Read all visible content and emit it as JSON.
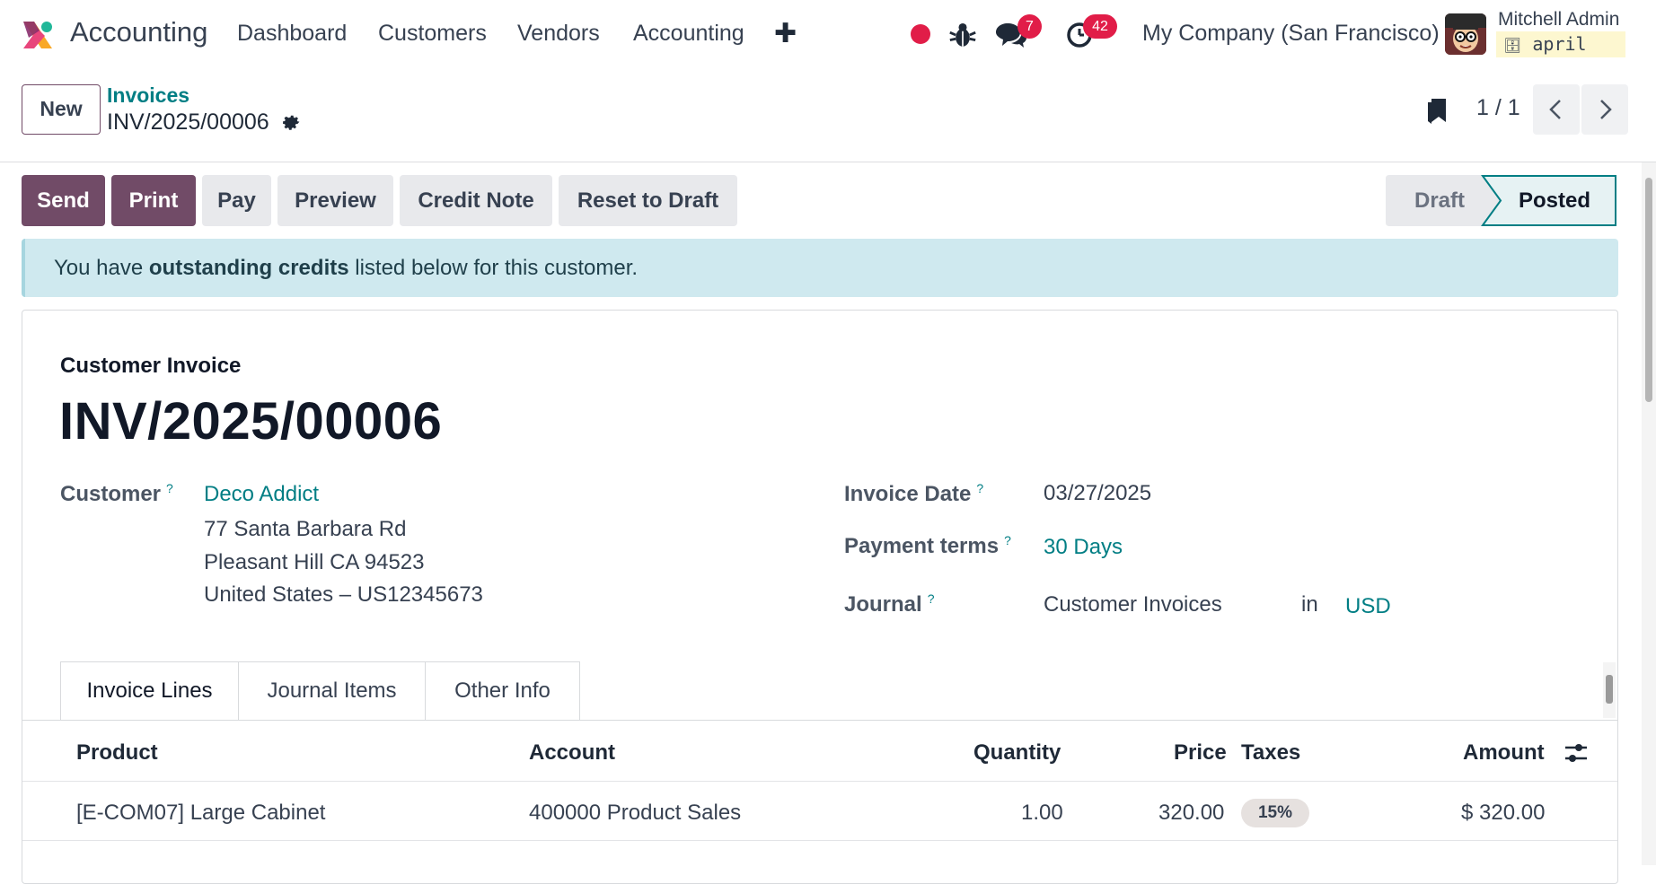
{
  "navbar": {
    "app_name": "Accounting",
    "menu": [
      "Dashboard",
      "Customers",
      "Vendors",
      "Accounting"
    ],
    "plus_icon": "plus-icon",
    "messages_count": "7",
    "activities_count": "42",
    "company": "My Company (San Francisco)",
    "user_name": "Mitchell Admin",
    "database": "april"
  },
  "control_panel": {
    "new_label": "New",
    "breadcrumb_parent": "Invoices",
    "breadcrumb_current": "INV/2025/00006",
    "pager": "1 / 1"
  },
  "actions": {
    "send": "Send",
    "print": "Print",
    "pay": "Pay",
    "preview": "Preview",
    "credit_note": "Credit Note",
    "reset_to_draft": "Reset to Draft"
  },
  "statusbar": {
    "draft": "Draft",
    "posted": "Posted",
    "active": "Posted"
  },
  "alert": {
    "prefix": "You have ",
    "bold": "outstanding credits",
    "suffix": " listed below for this customer."
  },
  "invoice": {
    "type": "Customer Invoice",
    "name": "INV/2025/00006",
    "customer_label": "Customer",
    "customer_name": "Deco Addict",
    "address_line1": "77 Santa Barbara Rd",
    "address_line2": "Pleasant Hill CA 94523",
    "address_line3": "United States – US12345673",
    "invoice_date_label": "Invoice Date",
    "invoice_date": "03/27/2025",
    "payment_terms_label": "Payment terms",
    "payment_terms": "30 Days",
    "journal_label": "Journal",
    "journal": "Customer Invoices",
    "journal_in": "in",
    "currency": "USD",
    "help_mark": "?"
  },
  "tabs": [
    "Invoice Lines",
    "Journal Items",
    "Other Info"
  ],
  "lines_table": {
    "headers": {
      "product": "Product",
      "account": "Account",
      "quantity": "Quantity",
      "price": "Price",
      "taxes": "Taxes",
      "amount": "Amount"
    },
    "rows": [
      {
        "product": "[E-COM07] Large Cabinet",
        "account": "400000 Product Sales",
        "quantity": "1.00",
        "price": "320.00",
        "taxes": "15%",
        "amount": "$ 320.00"
      }
    ]
  },
  "colors": {
    "primary": "#714b67",
    "link": "#017e84",
    "badge": "#e11d48",
    "alert_bg": "#cfe9ef"
  }
}
